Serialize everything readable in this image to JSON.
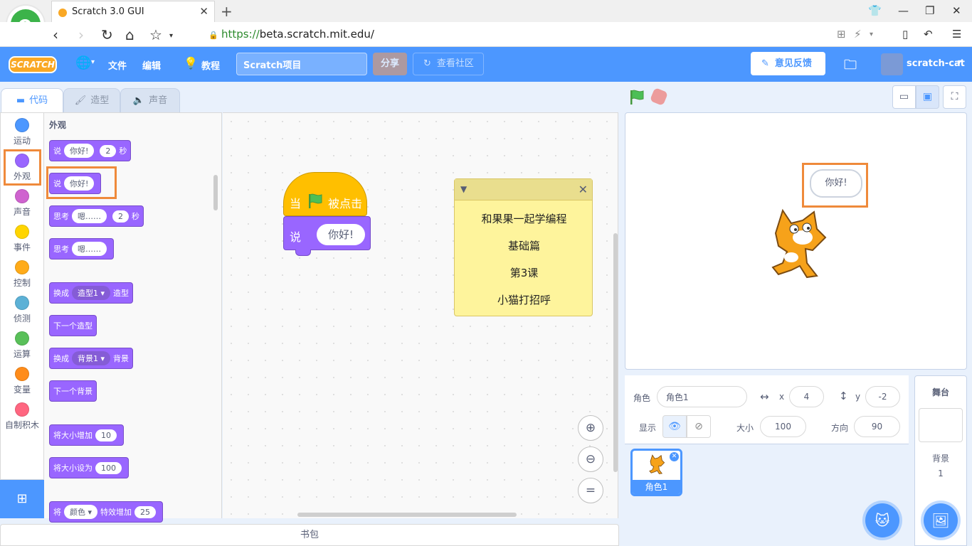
{
  "browser": {
    "tab_title": "Scratch 3.0 GUI",
    "url_scheme": "https://",
    "url_host": "beta.scratch.",
    "url_bold": "mit.edu",
    "url_path": "/"
  },
  "menubar": {
    "logo": "SCRATCH",
    "file": "文件",
    "edit": "编辑",
    "tutorials": "教程",
    "project_title": "Scratch项目",
    "share": "分享",
    "see_community": "查看社区",
    "feedback": "意见反馈",
    "username": "scratch-cat",
    "accent_color": "#4c97ff"
  },
  "editor_tabs": [
    {
      "label": "代码",
      "active": true
    },
    {
      "label": "造型",
      "active": false
    },
    {
      "label": "声音",
      "active": false
    }
  ],
  "categories": [
    {
      "label": "运动",
      "color": "#4c97ff"
    },
    {
      "label": "外观",
      "color": "#9966ff"
    },
    {
      "label": "声音",
      "color": "#cf63cf"
    },
    {
      "label": "事件",
      "color": "#ffd500"
    },
    {
      "label": "控制",
      "color": "#ffab19"
    },
    {
      "label": "侦测",
      "color": "#5cb1d6"
    },
    {
      "label": "运算",
      "color": "#59c059"
    },
    {
      "label": "变量",
      "color": "#ff8c1a"
    },
    {
      "label": "自制积木",
      "color": "#ff6680"
    }
  ],
  "palette": {
    "header": "外观",
    "blocks": {
      "say_secs": {
        "a": "说",
        "b": "你好!",
        "c": "2",
        "d": "秒"
      },
      "say": {
        "a": "说",
        "b": "你好!"
      },
      "think_secs": {
        "a": "思考",
        "b": "嗯……",
        "c": "2",
        "d": "秒"
      },
      "think": {
        "a": "思考",
        "b": "嗯……"
      },
      "switch_costume": {
        "a": "换成",
        "b": "造型1",
        "c": "造型"
      },
      "next_costume": {
        "a": "下一个造型"
      },
      "switch_backdrop": {
        "a": "换成",
        "b": "背景1",
        "c": "背景"
      },
      "next_backdrop": {
        "a": "下一个背景"
      },
      "change_size": {
        "a": "将大小增加",
        "b": "10"
      },
      "set_size": {
        "a": "将大小设为",
        "b": "100"
      },
      "change_effect": {
        "a": "将",
        "b": "颜色",
        "c": "特效增加",
        "d": "25"
      }
    }
  },
  "script": {
    "hat": {
      "when": "当",
      "clicked": "被点击"
    },
    "say": {
      "label": "说",
      "value": "你好!"
    }
  },
  "note": {
    "lines": [
      "和果果一起学编程",
      "基础篇",
      "第3课",
      "小猫打招呼"
    ]
  },
  "backpack": "书包",
  "stage": {
    "bubble": "你好!"
  },
  "sprite_info": {
    "sprite_label": "角色",
    "sprite_name": "角色1",
    "x_label": "x",
    "x": "4",
    "y_label": "y",
    "y": "-2",
    "show_label": "显示",
    "size_label": "大小",
    "size": "100",
    "direction_label": "方向",
    "direction": "90"
  },
  "sprites": [
    {
      "name": "角色1"
    }
  ],
  "stage_panel": {
    "title": "舞台",
    "backdrops_label": "背景",
    "backdrops_count": "1"
  }
}
